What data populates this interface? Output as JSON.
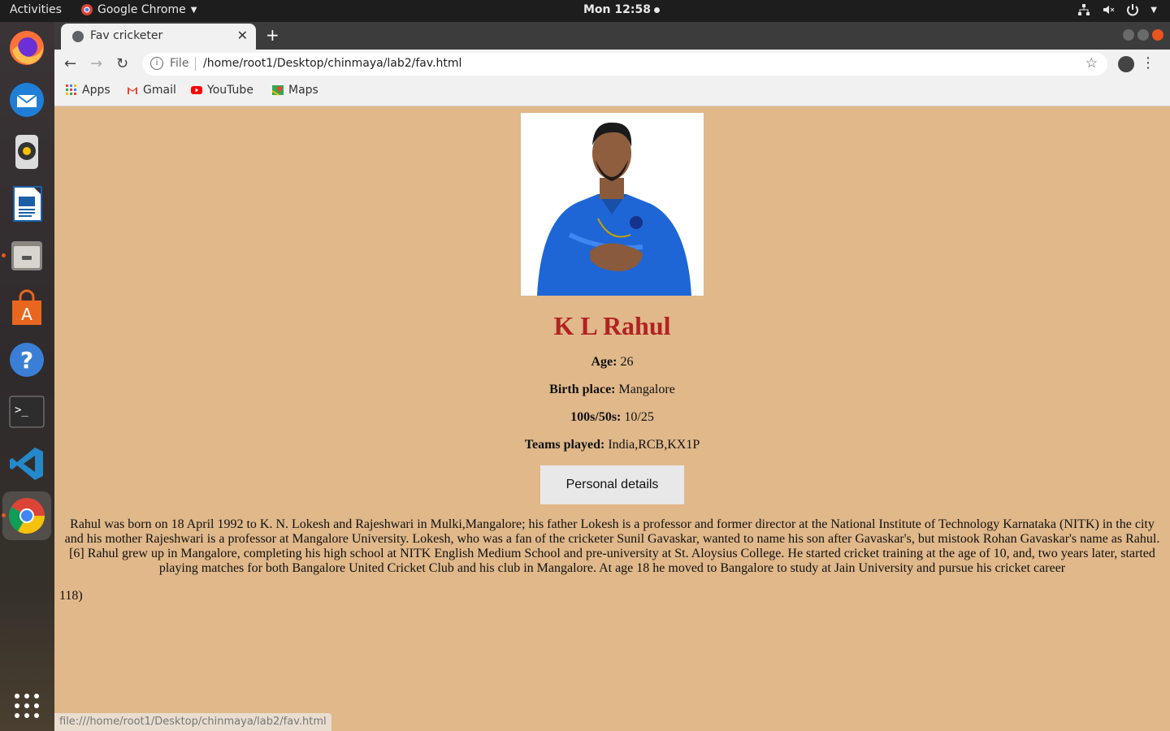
{
  "topbar": {
    "activities": "Activities",
    "app_name": "Google Chrome",
    "clock": "Mon 12:58"
  },
  "dock": {
    "items": [
      "firefox-icon",
      "thunderbird-icon",
      "rhythmbox-icon",
      "writer-icon",
      "files-icon",
      "software-icon",
      "help-icon",
      "terminal-icon",
      "vscode-icon",
      "chrome-icon",
      "show-apps-icon"
    ]
  },
  "browser": {
    "tab_title": "Fav cricketer",
    "omnibox_scheme": "File",
    "omnibox_url": "/home/root1/Desktop/chinmaya/lab2/fav.html",
    "bookmarks": [
      "Apps",
      "Gmail",
      "YouTube",
      "Maps"
    ],
    "status_url": "file:///home/root1/Desktop/chinmaya/lab2/fav.html"
  },
  "page": {
    "name": "K L Rahul",
    "age_label": "Age:",
    "age_value": "26",
    "birth_label": "Birth place:",
    "birth_value": "Mangalore",
    "centuries_label": "100s/50s:",
    "centuries_value": "10/25",
    "teams_label": "Teams played:",
    "teams_value": "India,RCB,KX1P",
    "button_label": "Personal details",
    "bio": "Rahul was born on 18 April 1992 to K. N. Lokesh and Rajeshwari in Mulki,Mangalore; his father Lokesh is a professor and former director at the National Institute of Technology Karnataka (NITK) in the city and his mother Rajeshwari is a professor at Mangalore University. Lokesh, who was a fan of the cricketer Sunil Gavaskar, wanted to name his son after Gavaskar's, but mistook Rohan Gavaskar's name as Rahul.[6] Rahul grew up in Mangalore, completing his high school at NITK English Medium School and pre-university at St. Aloysius College. He started cricket training at the age of 10, and, two years later, started playing matches for both Bangalore United Cricket Club and his club in Mangalore. At age 18 he moved to Bangalore to study at Jain University and pursue his cricket career",
    "footnote": "118)"
  },
  "colors": {
    "page_bg": "#e0b88a",
    "name_color": "#b22222",
    "button_bg": "#e8e8e8"
  }
}
